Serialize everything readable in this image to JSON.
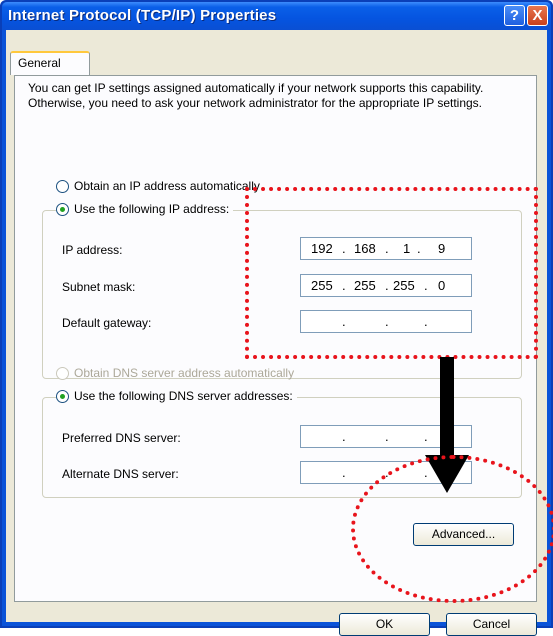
{
  "window": {
    "title": "Internet Protocol (TCP/IP) Properties",
    "help_label": "?",
    "close_label": "X"
  },
  "tabs": [
    {
      "label": "General"
    }
  ],
  "intro_text": "You can get IP settings assigned automatically if your network supports this capability. Otherwise, you need to ask your network administrator for the appropriate IP settings.",
  "ip": {
    "auto_label": "Obtain an IP address automatically",
    "manual_label": "Use the following IP address:",
    "selected": "manual",
    "fields": [
      {
        "label": "IP address:",
        "octets": [
          "192",
          "168",
          "1",
          "9"
        ]
      },
      {
        "label": "Subnet mask:",
        "octets": [
          "255",
          "255",
          "255",
          "0"
        ]
      },
      {
        "label": "Default gateway:",
        "octets": [
          "",
          "",
          "",
          ""
        ]
      }
    ]
  },
  "dns": {
    "auto_label": "Obtain DNS server address automatically",
    "manual_label": "Use the following DNS server addresses:",
    "selected": "manual",
    "fields": [
      {
        "label": "Preferred DNS server:",
        "octets": [
          "",
          "",
          "",
          ""
        ]
      },
      {
        "label": "Alternate DNS server:",
        "octets": [
          "",
          "",
          "",
          ""
        ]
      }
    ]
  },
  "buttons": {
    "advanced": "Advanced...",
    "ok": "OK",
    "cancel": "Cancel"
  },
  "colors": {
    "titlebar": "#0a5fe8",
    "annotation": "#e8141c",
    "arrow": "#000000"
  }
}
